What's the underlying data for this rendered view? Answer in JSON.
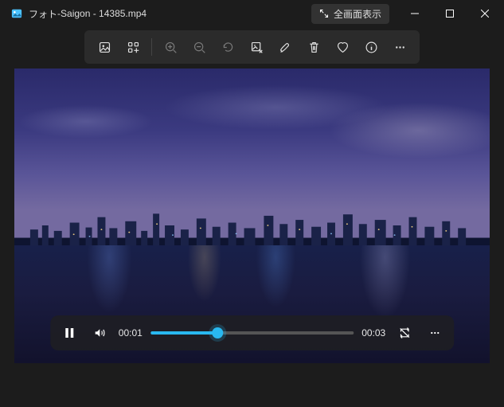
{
  "titlebar": {
    "app_name": "フォト",
    "separator": " - ",
    "file_name": "Saigon - 14385.mp4",
    "fullscreen_label": "全画面表示"
  },
  "toolbar": {
    "items": {
      "gallery": "gallery-icon",
      "apps": "apps-grid-icon",
      "zoom_in": "zoom-in-icon",
      "zoom_out": "zoom-out-icon",
      "rotate": "rotate-icon",
      "edit_image": "edit-image-icon",
      "markup": "markup-icon",
      "delete": "trash-icon",
      "favorite": "heart-icon",
      "info": "info-icon",
      "more": "more-icon"
    }
  },
  "playback": {
    "state": "playing",
    "current_time": "00:01",
    "duration": "00:03",
    "progress_percent": 33,
    "volume_on": true,
    "loop": false
  },
  "colors": {
    "accent": "#29b8f0",
    "toolbar_bg": "#2b2b2b",
    "window_bg": "#1c1c1c"
  }
}
